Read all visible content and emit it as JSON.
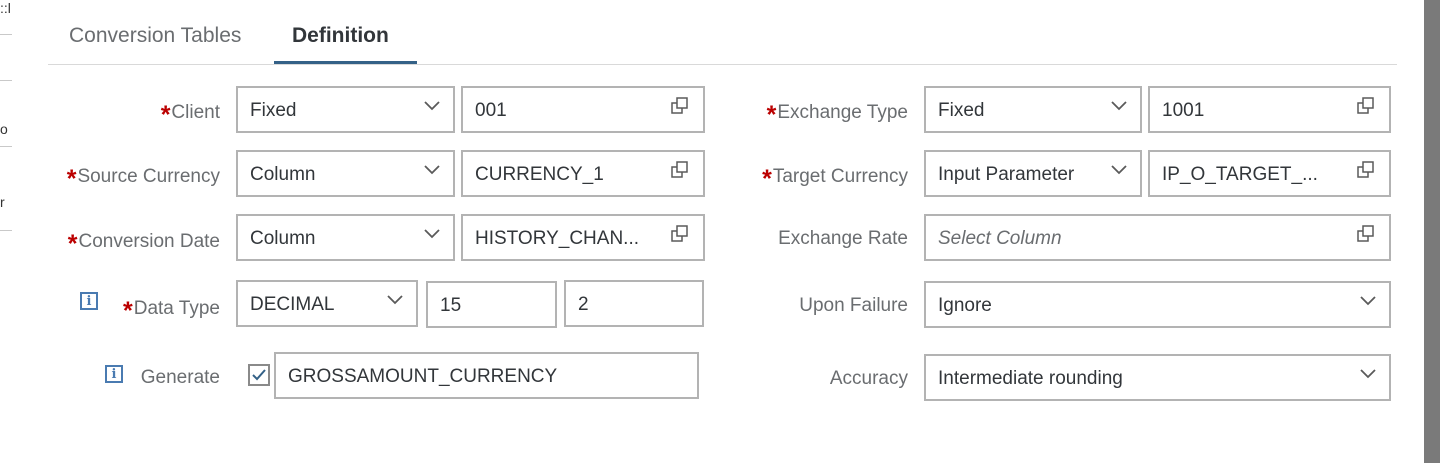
{
  "background": {
    "edge_texts": [
      "::l",
      "o",
      "r"
    ]
  },
  "tabs": [
    {
      "label": "Conversion Tables",
      "active": false
    },
    {
      "label": "Definition",
      "active": true
    }
  ],
  "left": {
    "client": {
      "label": "Client",
      "required": true,
      "type": "Fixed",
      "value": "001"
    },
    "source_currency": {
      "label": "Source Currency",
      "required": true,
      "type": "Column",
      "value": "CURRENCY_1"
    },
    "conversion_date": {
      "label": "Conversion Date",
      "required": true,
      "type": "Column",
      "value": "HISTORY_CHAN..."
    },
    "data_type": {
      "label": "Data Type",
      "required": true,
      "type": "DECIMAL",
      "length": "15",
      "scale": "2"
    },
    "generate": {
      "label": "Generate",
      "checked": true,
      "value": "GROSSAMOUNT_CURRENCY"
    }
  },
  "right": {
    "exchange_type": {
      "label": "Exchange Type",
      "required": true,
      "type": "Fixed",
      "value": "1001"
    },
    "target_currency": {
      "label": "Target Currency",
      "required": true,
      "type": "Input Parameter",
      "value": "IP_O_TARGET_..."
    },
    "exchange_rate": {
      "label": "Exchange Rate",
      "required": false,
      "placeholder": "Select Column"
    },
    "upon_failure": {
      "label": "Upon Failure",
      "value": "Ignore"
    },
    "accuracy": {
      "label": "Accuracy",
      "value": "Intermediate rounding"
    }
  },
  "required_marker": "*",
  "info_glyph": "i",
  "colors": {
    "required": "#bb0000",
    "tab_underline": "#346187",
    "info_icon": "#4a7bb1"
  }
}
